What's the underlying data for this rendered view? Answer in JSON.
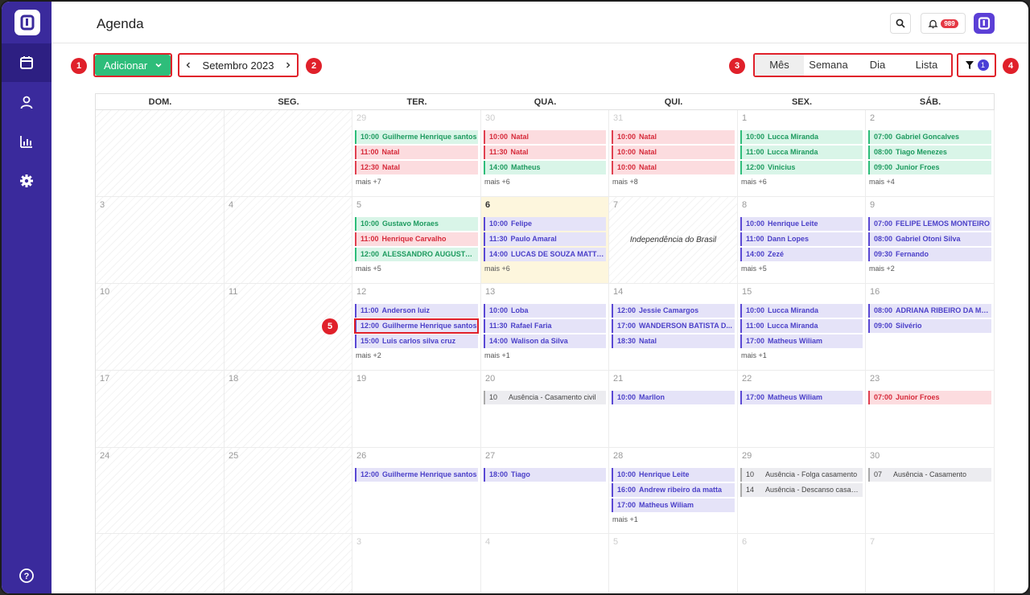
{
  "header": {
    "title": "Agenda",
    "notifications": "989"
  },
  "toolbar": {
    "add_label": "Adicionar",
    "month_label": "Setembro 2023",
    "views": [
      "Mês",
      "Semana",
      "Dia",
      "Lista"
    ],
    "active_view": "Mês",
    "filter_count": "1"
  },
  "markers": [
    "1",
    "2",
    "3",
    "4",
    "5"
  ],
  "calendar": {
    "weekdays": [
      "DOM.",
      "SEG.",
      "TER.",
      "QUA.",
      "QUI.",
      "SEX.",
      "SÁB."
    ],
    "weeks": [
      [
        {
          "day": "",
          "disabled": true,
          "events": []
        },
        {
          "day": "",
          "disabled": true,
          "events": []
        },
        {
          "day": "29",
          "dim": true,
          "events": [
            {
              "time": "10:00",
              "title": "Guilherme Henrique santos",
              "color": "green"
            },
            {
              "time": "11:00",
              "title": "Natal",
              "color": "red"
            },
            {
              "time": "12:30",
              "title": "Natal",
              "color": "red"
            }
          ],
          "more": "mais +7"
        },
        {
          "day": "30",
          "dim": true,
          "events": [
            {
              "time": "10:00",
              "title": "Natal",
              "color": "red"
            },
            {
              "time": "11:30",
              "title": "Natal",
              "color": "red"
            },
            {
              "time": "14:00",
              "title": "Matheus",
              "color": "green"
            }
          ],
          "more": "mais +6"
        },
        {
          "day": "31",
          "dim": true,
          "events": [
            {
              "time": "10:00",
              "title": "Natal",
              "color": "red"
            },
            {
              "time": "10:00",
              "title": "Natal",
              "color": "red"
            },
            {
              "time": "10:00",
              "title": "Natal",
              "color": "red"
            }
          ],
          "more": "mais +8"
        },
        {
          "day": "1",
          "events": [
            {
              "time": "10:00",
              "title": "Lucca Miranda",
              "color": "green"
            },
            {
              "time": "11:00",
              "title": "Lucca Miranda",
              "color": "green"
            },
            {
              "time": "12:00",
              "title": "Vinicius",
              "color": "green"
            }
          ],
          "more": "mais +6"
        },
        {
          "day": "2",
          "events": [
            {
              "time": "07:00",
              "title": "Gabriel Goncalves",
              "color": "green"
            },
            {
              "time": "08:00",
              "title": "Tiago Menezes",
              "color": "green"
            },
            {
              "time": "09:00",
              "title": "Junior Froes",
              "color": "green"
            }
          ],
          "more": "mais +4"
        }
      ],
      [
        {
          "day": "3",
          "disabled": true,
          "events": []
        },
        {
          "day": "4",
          "disabled": true,
          "events": []
        },
        {
          "day": "5",
          "events": [
            {
              "time": "10:00",
              "title": "Gustavo Moraes",
              "color": "green"
            },
            {
              "time": "11:00",
              "title": "Henrique Carvalho",
              "color": "red"
            },
            {
              "time": "12:00",
              "title": "ALESSANDRO AUGUSTO ...",
              "color": "green"
            }
          ],
          "more": "mais +5"
        },
        {
          "day": "6",
          "today": true,
          "events": [
            {
              "time": "10:00",
              "title": "Felipe",
              "color": "purple"
            },
            {
              "time": "11:30",
              "title": "Paulo Amaral",
              "color": "purple"
            },
            {
              "time": "14:00",
              "title": "LUCAS DE SOUZA MATTOS",
              "color": "purple"
            }
          ],
          "more": "mais +6"
        },
        {
          "day": "7",
          "disabled": true,
          "holiday": "Independência do Brasil",
          "events": []
        },
        {
          "day": "8",
          "events": [
            {
              "time": "10:00",
              "title": "Henrique Leite",
              "color": "purple"
            },
            {
              "time": "11:00",
              "title": "Dann Lopes",
              "color": "purple"
            },
            {
              "time": "14:00",
              "title": "Zezé",
              "color": "purple"
            }
          ],
          "more": "mais +5"
        },
        {
          "day": "9",
          "events": [
            {
              "time": "07:00",
              "title": "FELIPE LEMOS MONTEIRO",
              "color": "purple"
            },
            {
              "time": "08:00",
              "title": "Gabriel Otoni Silva",
              "color": "purple"
            },
            {
              "time": "09:30",
              "title": "Fernando",
              "color": "purple"
            }
          ],
          "more": "mais +2"
        }
      ],
      [
        {
          "day": "10",
          "disabled": true,
          "events": []
        },
        {
          "day": "11",
          "disabled": true,
          "events": []
        },
        {
          "day": "12",
          "events": [
            {
              "time": "11:00",
              "title": "Anderson luiz",
              "color": "purple"
            },
            {
              "time": "12:00",
              "title": "Guilherme Henrique santos",
              "color": "purple",
              "highlight": true
            },
            {
              "time": "15:00",
              "title": "Luis carlos silva cruz",
              "color": "purple"
            }
          ],
          "more": "mais +2"
        },
        {
          "day": "13",
          "events": [
            {
              "time": "10:00",
              "title": "Loba",
              "color": "purple"
            },
            {
              "time": "11:30",
              "title": "Rafael Faria",
              "color": "purple"
            },
            {
              "time": "14:00",
              "title": "Walison da Silva",
              "color": "purple"
            }
          ],
          "more": "mais +1"
        },
        {
          "day": "14",
          "events": [
            {
              "time": "12:00",
              "title": "Jessie Camargos",
              "color": "purple"
            },
            {
              "time": "17:00",
              "title": "WANDERSON BATISTA D...",
              "color": "purple"
            },
            {
              "time": "18:30",
              "title": "Natal",
              "color": "purple"
            }
          ]
        },
        {
          "day": "15",
          "events": [
            {
              "time": "10:00",
              "title": "Lucca Miranda",
              "color": "purple"
            },
            {
              "time": "11:00",
              "title": "Lucca Miranda",
              "color": "purple"
            },
            {
              "time": "17:00",
              "title": "Matheus Wiliam",
              "color": "purple"
            }
          ],
          "more": "mais +1"
        },
        {
          "day": "16",
          "events": [
            {
              "time": "08:00",
              "title": "ADRIANA RIBEIRO DA MA...",
              "color": "purple"
            },
            {
              "time": "09:00",
              "title": "Silvério",
              "color": "purple"
            }
          ]
        }
      ],
      [
        {
          "day": "17",
          "disabled": true,
          "events": []
        },
        {
          "day": "18",
          "disabled": true,
          "events": []
        },
        {
          "day": "19",
          "events": []
        },
        {
          "day": "20",
          "events": [
            {
              "time": "10",
              "title": "Ausência - Casamento civil",
              "color": "gray"
            }
          ]
        },
        {
          "day": "21",
          "events": [
            {
              "time": "10:00",
              "title": "Marllon",
              "color": "purple"
            }
          ]
        },
        {
          "day": "22",
          "events": [
            {
              "time": "17:00",
              "title": "Matheus Wiliam",
              "color": "purple"
            }
          ]
        },
        {
          "day": "23",
          "events": [
            {
              "time": "07:00",
              "title": "Junior Froes",
              "color": "red"
            }
          ]
        }
      ],
      [
        {
          "day": "24",
          "disabled": true,
          "events": []
        },
        {
          "day": "25",
          "disabled": true,
          "events": []
        },
        {
          "day": "26",
          "events": [
            {
              "time": "12:00",
              "title": "Guilherme Henrique santos",
              "color": "purple"
            }
          ]
        },
        {
          "day": "27",
          "events": [
            {
              "time": "18:00",
              "title": "Tiago",
              "color": "purple"
            }
          ]
        },
        {
          "day": "28",
          "events": [
            {
              "time": "10:00",
              "title": "Henrique Leite",
              "color": "purple"
            },
            {
              "time": "16:00",
              "title": "Andrew ribeiro da matta",
              "color": "purple"
            },
            {
              "time": "17:00",
              "title": "Matheus Wiliam",
              "color": "purple"
            }
          ],
          "more": "mais +1"
        },
        {
          "day": "29",
          "events": [
            {
              "time": "10",
              "title": "Ausência - Folga casamento",
              "color": "gray"
            },
            {
              "time": "14",
              "title": "Ausência - Descanso casamento",
              "color": "gray"
            }
          ]
        },
        {
          "day": "30",
          "events": [
            {
              "time": "07",
              "title": "Ausência - Casamento",
              "color": "gray"
            }
          ]
        }
      ],
      [
        {
          "day": "",
          "disabled": true,
          "events": []
        },
        {
          "day": "",
          "disabled": true,
          "events": []
        },
        {
          "day": "3",
          "dim": true,
          "events": []
        },
        {
          "day": "4",
          "dim": true,
          "events": []
        },
        {
          "day": "5",
          "dim": true,
          "events": []
        },
        {
          "day": "6",
          "dim": true,
          "events": []
        },
        {
          "day": "7",
          "dim": true,
          "events": []
        }
      ]
    ]
  }
}
